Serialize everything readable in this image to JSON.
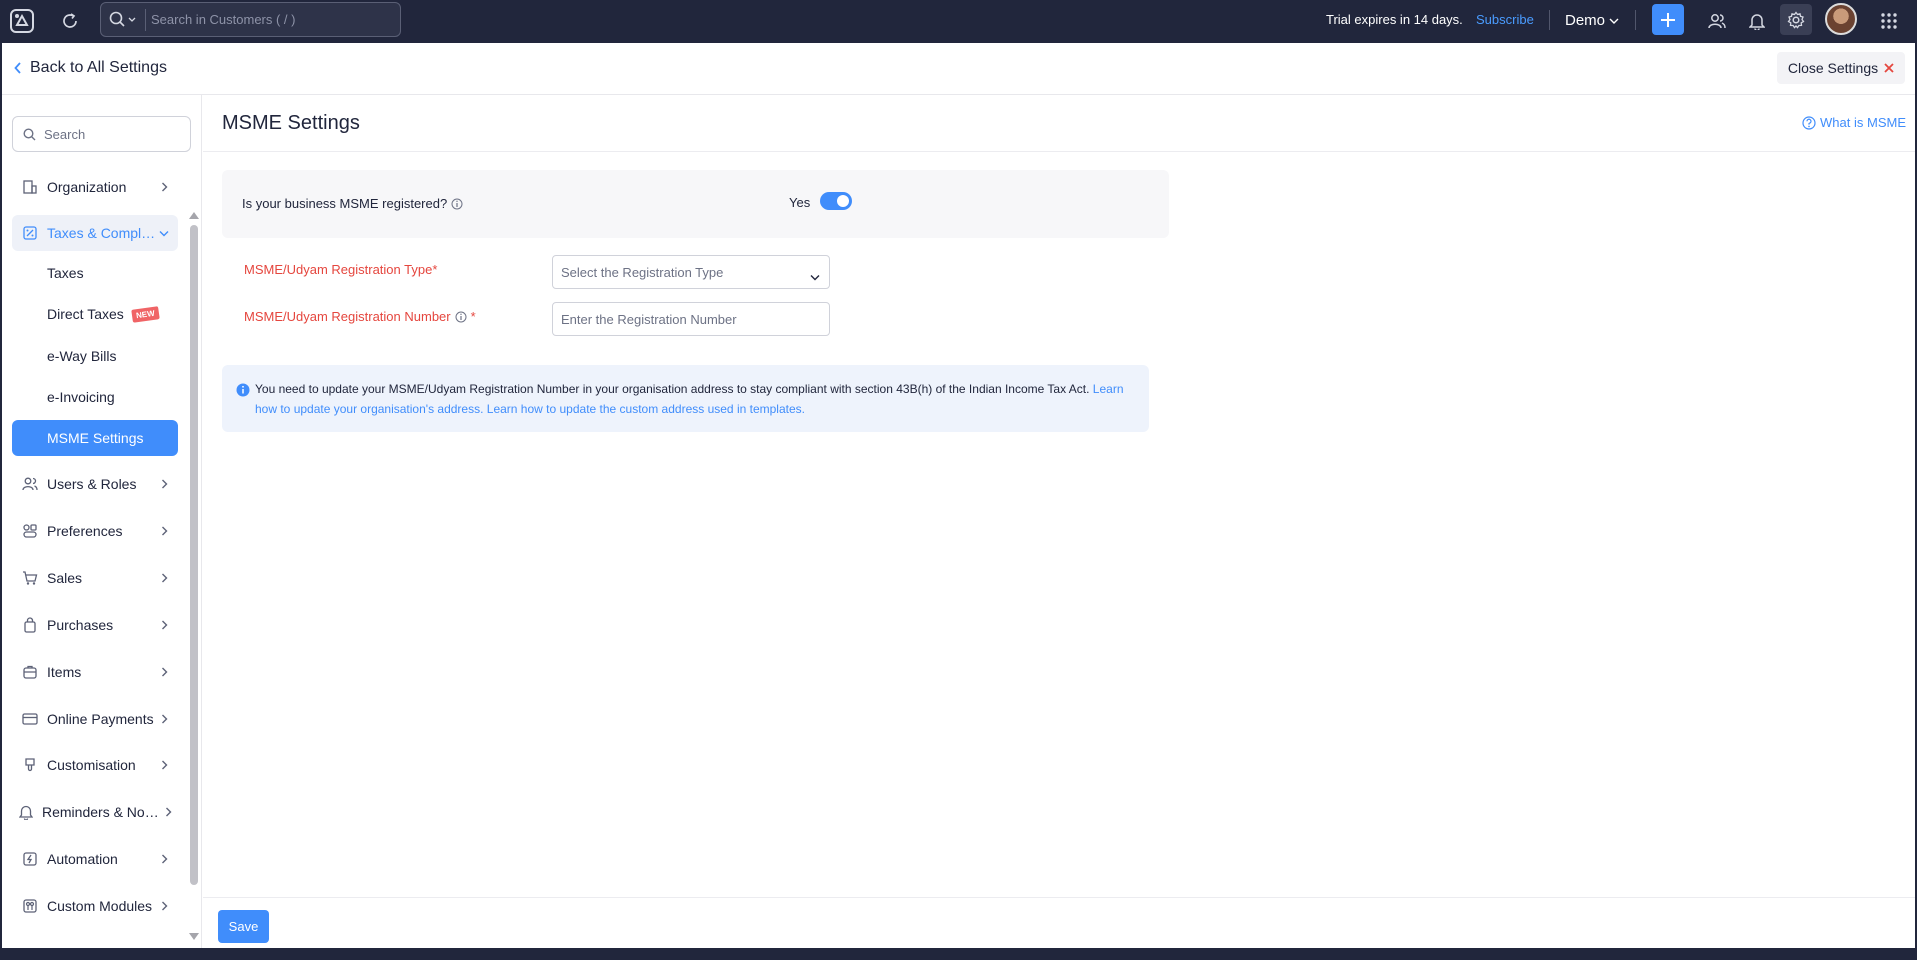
{
  "colors": {
    "topbar": "#21263c",
    "accent": "#408dfb",
    "required": "#e5463e",
    "info_bg": "#eef3fc"
  },
  "topbar": {
    "search_placeholder": "Search in Customers ( / )",
    "trial_text": "Trial expires in 14 days.",
    "subscribe_label": "Subscribe",
    "org_name": "Demo",
    "icons": [
      "app-logo-icon",
      "recent-icon",
      "search-icon",
      "plus-icon",
      "users-icon",
      "bell-icon",
      "gear-icon",
      "apps-grid-icon"
    ]
  },
  "header": {
    "back_label": "Back to All Settings",
    "close_label": "Close Settings"
  },
  "sidebar": {
    "search_placeholder": "Search",
    "items": [
      {
        "label": "Organization",
        "icon": "building-icon"
      },
      {
        "label": "Taxes & Complia...",
        "icon": "tax-icon",
        "open": true
      },
      {
        "label": "Users & Roles",
        "icon": "users-icon"
      },
      {
        "label": "Preferences",
        "icon": "preferences-icon"
      },
      {
        "label": "Sales",
        "icon": "cart-icon"
      },
      {
        "label": "Purchases",
        "icon": "bag-icon"
      },
      {
        "label": "Items",
        "icon": "box-icon"
      },
      {
        "label": "Online Payments",
        "icon": "card-icon"
      },
      {
        "label": "Customisation",
        "icon": "brush-icon"
      },
      {
        "label": "Reminders & Noti...",
        "icon": "bell-icon"
      },
      {
        "label": "Automation",
        "icon": "bolt-icon"
      },
      {
        "label": "Custom Modules",
        "icon": "modules-icon"
      }
    ],
    "sub_items": [
      {
        "label": "Taxes"
      },
      {
        "label": "Direct Taxes",
        "badge": "NEW"
      },
      {
        "label": "e-Way Bills"
      },
      {
        "label": "e-Invoicing"
      },
      {
        "label": "MSME Settings",
        "active": true
      }
    ]
  },
  "content": {
    "title": "MSME Settings",
    "help_link": "What is MSME",
    "question": "Is your business MSME registered?",
    "toggle_label": "Yes",
    "toggle_on": true,
    "type_label": "MSME/Udyam Registration Type*",
    "type_placeholder": "Select the Registration Type",
    "number_label": "MSME/Udyam Registration Number",
    "number_required": "*",
    "number_placeholder": "Enter the Registration Number",
    "info_text": "You need to update your MSME/Udyam Registration Number in your organisation address to stay compliant with section 43B(h) of the Indian Income Tax Act.",
    "info_link1": "Learn how to update your organisation's address.",
    "info_link2": "Learn how to update the custom address used in templates.",
    "save_label": "Save"
  }
}
